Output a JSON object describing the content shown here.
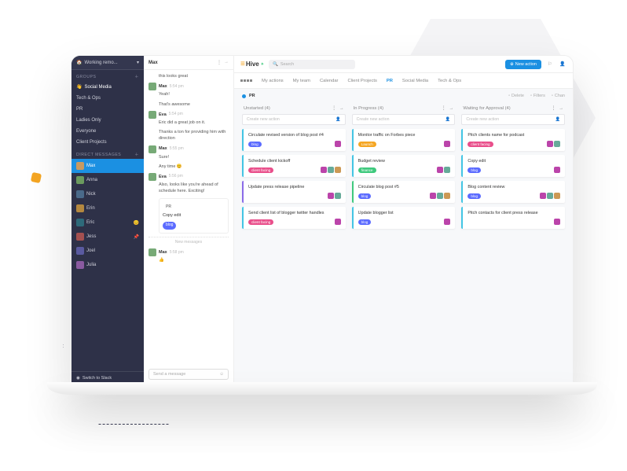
{
  "brand": "Hive",
  "search_placeholder": "Search",
  "new_action_btn": "New action",
  "workspace": {
    "name": "Working remo..."
  },
  "sidebar": {
    "groups_label": "GROUPS",
    "dm_label": "DIRECT MESSAGES",
    "groups": [
      {
        "label": "Social Media",
        "emoji": "👋",
        "sel": true
      },
      {
        "label": "Tech & Ops"
      },
      {
        "label": "PR"
      },
      {
        "label": "Ladies Only"
      },
      {
        "label": "Everyone"
      },
      {
        "label": "Client Projects"
      }
    ],
    "dms": [
      {
        "label": "Max",
        "active": true,
        "color": "#c79a62"
      },
      {
        "label": "Anna",
        "color": "#6b9a5e"
      },
      {
        "label": "Nick",
        "color": "#4a6a8a"
      },
      {
        "label": "Erin",
        "color": "#b4883f"
      },
      {
        "label": "Eric",
        "emoji": "😊",
        "color": "#2e6a7a"
      },
      {
        "label": "Jess",
        "emoji": "📌",
        "color": "#a45050"
      },
      {
        "label": "Joel",
        "color": "#5a5aa0"
      },
      {
        "label": "Julia",
        "color": "#8a5aa0"
      }
    ],
    "slack": "Switch to Slack"
  },
  "chat": {
    "title": "Max",
    "messages": [
      {
        "user": "",
        "time": "",
        "text": "this looks great"
      },
      {
        "user": "Max",
        "time": "5:54 pm",
        "text": "Yeah!"
      },
      {
        "user": "",
        "time": "",
        "text": "That's awesome"
      },
      {
        "user": "Eva",
        "time": "5:54 pm",
        "text": "Eric did a great job on it."
      },
      {
        "user": "",
        "time": "",
        "text": "Thanks a ton for providing him with direction"
      },
      {
        "user": "Max",
        "time": "5:55 pm",
        "text": "Sure!"
      },
      {
        "user": "",
        "time": "",
        "text": "Any time 😊"
      },
      {
        "user": "Eva",
        "time": "5:56 pm",
        "text": "Also, looks like you're ahead of schedule here. Exciting!"
      }
    ],
    "attachment": {
      "project": "PR",
      "title": "Copy edit",
      "tag": "blog"
    },
    "new_messages_label": "New messages",
    "last": {
      "user": "Max",
      "time": "5:58 pm",
      "emoji": "👍"
    },
    "input_placeholder": "Send a message"
  },
  "tabs": [
    "My actions",
    "My team",
    "Calendar",
    "Client Projects",
    "PR",
    "Social Media",
    "Tech & Ops"
  ],
  "active_tab": "PR",
  "subbar": {
    "project": "PR",
    "right": [
      "Delete",
      "Filters",
      "Chan"
    ]
  },
  "board": {
    "new_action_placeholder": "Create new action",
    "columns": [
      {
        "title": "Unstarted",
        "count": 4,
        "cards": [
          {
            "title": "Circulate revised version of blog post #4",
            "tag": "blog",
            "border": "bl",
            "avs": 1
          },
          {
            "title": "Schedule client kickoff",
            "tag": "client facing",
            "tagc": "client",
            "border": "bl",
            "avs": 3
          },
          {
            "title": "Update press release pipeline",
            "border": "pu",
            "avs": 2
          },
          {
            "title": "Send client list of blogger twitter handles",
            "tag": "client facing",
            "tagc": "client",
            "border": "bl",
            "avs": 1
          }
        ]
      },
      {
        "title": "In Progress",
        "count": 4,
        "cards": [
          {
            "title": "Monitor traffic on Forbes piece",
            "tag": "Launch",
            "tagc": "launch",
            "border": "bl",
            "avs": 1
          },
          {
            "title": "Budget review",
            "tag": "finance",
            "tagc": "finance",
            "border": "bl",
            "avs": 2
          },
          {
            "title": "Circulate blog post #5",
            "tag": "blog",
            "border": "gr",
            "avs": 3
          },
          {
            "title": "Update blogger list",
            "tag": "blog",
            "border": "bl",
            "avs": 1
          }
        ]
      },
      {
        "title": "Waiting for Approval",
        "count": 4,
        "cards": [
          {
            "title": "Pitch clients name for podcast",
            "tag": "client facing",
            "tagc": "client",
            "border": "bl",
            "avs": 2
          },
          {
            "title": "Copy edit",
            "tag": "blog",
            "border": "bl",
            "avs": 1
          },
          {
            "title": "Blog content review",
            "tag": "blog",
            "border": "bl",
            "avs": 3
          },
          {
            "title": "Pitch contacts for client press release",
            "border": "bl",
            "avs": 1
          }
        ]
      }
    ]
  }
}
